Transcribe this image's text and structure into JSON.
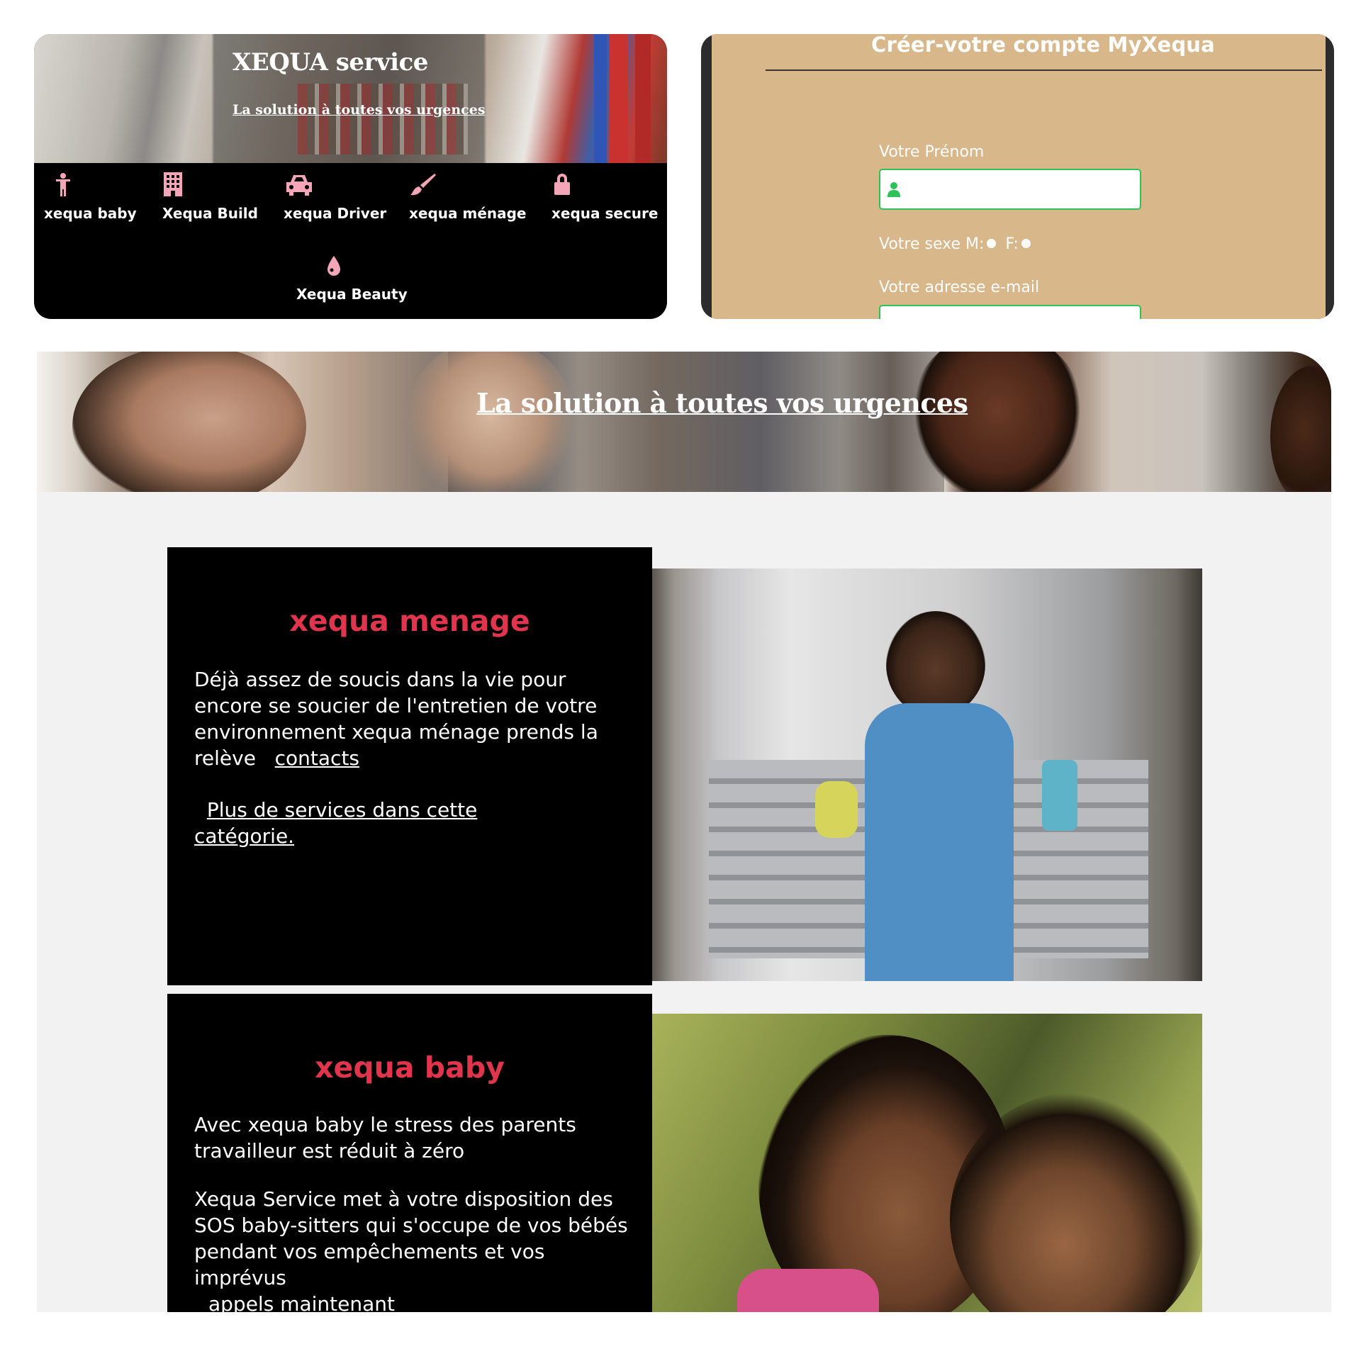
{
  "services_card": {
    "title": "XEQUA service",
    "subtitle": "La solution à toutes vos urgences",
    "services": [
      {
        "label": "xequa baby",
        "icon": "child-icon"
      },
      {
        "label": "Xequa Build",
        "icon": "building-icon"
      },
      {
        "label": "xequa Driver",
        "icon": "car-icon"
      },
      {
        "label": "xequa ménage",
        "icon": "brush-icon"
      },
      {
        "label": "xequa secure",
        "icon": "lock-icon"
      },
      {
        "label": "Xequa Beauty",
        "icon": "drop-icon"
      }
    ],
    "icon_color": "#f4a6b6"
  },
  "signup": {
    "title": "Créer-votre compte MyXequa",
    "firstname_label": "Votre Prénom",
    "firstname_value": "",
    "sex_label": "Votre sexe M:",
    "sex_f_label": "F:",
    "email_label": "Votre adresse e-mail",
    "accent_color": "#2fc25a"
  },
  "main": {
    "banner_text": "La solution à toutes vos urgences",
    "menage": {
      "title": "xequa menage",
      "text": "Déjà assez de soucis dans la vie pour encore se soucier de l'entretien de votre environnement xequa ménage prends la relève",
      "contacts_link": "contacts",
      "more_link": "Plus de services dans cette catégorie."
    },
    "baby": {
      "title": "xequa baby",
      "text1": "Avec xequa baby le stress des parents travailleur est réduit à zéro",
      "text2": "Xequa Service met à votre disposition des SOS baby-sitters qui s'occupe de vos bébés pendant vos empêchements et vos imprévus",
      "text3": "appels maintenant"
    },
    "title_color": "#e0354c"
  }
}
